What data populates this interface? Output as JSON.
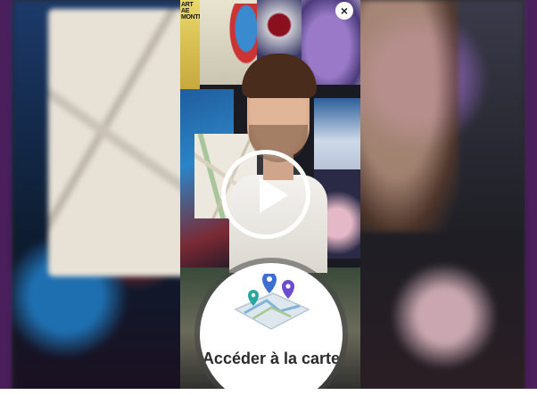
{
  "story_header": {
    "tile_text": "ART\nAE\nMONTM"
  },
  "close_button": {
    "glyph": "×"
  },
  "media": {
    "state": "paused"
  },
  "map_cta": {
    "label": "Accéder à la carte"
  },
  "colors": {
    "frame_purple": "#4a1f5c",
    "cta_background": "#ffffff",
    "cta_text": "#2b2b2b"
  }
}
